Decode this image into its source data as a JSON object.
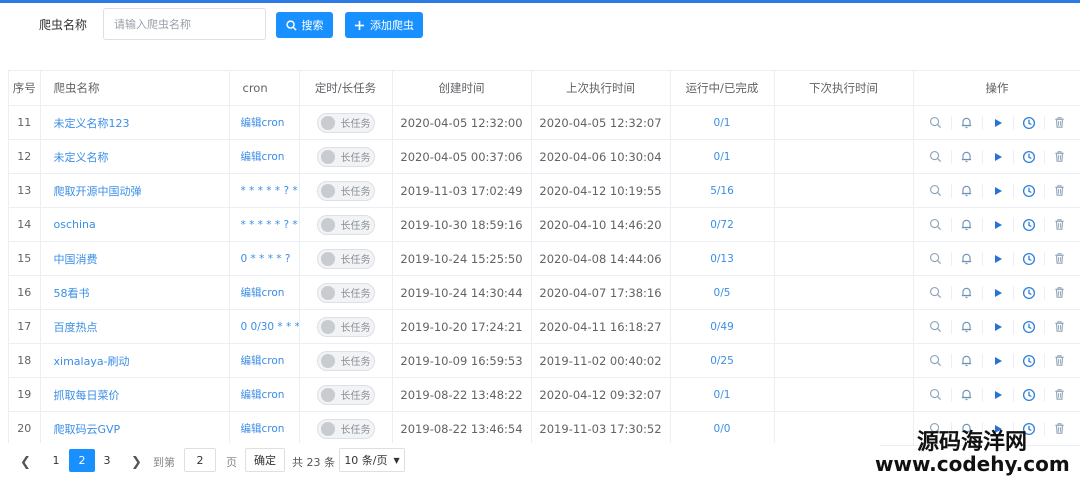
{
  "search": {
    "label": "爬虫名称",
    "placeholder": "请输入爬虫名称",
    "search_button": "搜索",
    "add_button": "添加爬虫"
  },
  "table": {
    "headers": {
      "index": "序号",
      "name": "爬虫名称",
      "cron": "cron",
      "task_type": "定时/长任务",
      "created": "创建时间",
      "last_run": "上次执行时间",
      "progress": "运行中/已完成",
      "next_run": "下次执行时间",
      "actions": "操作"
    },
    "switch_label": "长任务",
    "rows": [
      {
        "index": "11",
        "name": "未定义名称123",
        "cron": "编辑cron",
        "created": "2020-04-05 12:32:00",
        "last_run": "2020-04-05 12:32:07",
        "progress": "0/1",
        "next_run": ""
      },
      {
        "index": "12",
        "name": "未定义名称",
        "cron": "编辑cron",
        "created": "2020-04-05 00:37:06",
        "last_run": "2020-04-06 10:30:04",
        "progress": "0/1",
        "next_run": ""
      },
      {
        "index": "13",
        "name": "爬取开源中国动弹",
        "cron": "* * * * * ? * ...",
        "created": "2019-11-03 17:02:49",
        "last_run": "2020-04-12 10:19:55",
        "progress": "5/16",
        "next_run": ""
      },
      {
        "index": "14",
        "name": "oschina",
        "cron": "* * * * * ? * ...",
        "created": "2019-10-30 18:59:16",
        "last_run": "2020-04-10 14:46:20",
        "progress": "0/72",
        "next_run": ""
      },
      {
        "index": "15",
        "name": "中国消费",
        "cron": "0 * * * * ?",
        "created": "2019-10-24 15:25:50",
        "last_run": "2020-04-08 14:44:06",
        "progress": "0/13",
        "next_run": ""
      },
      {
        "index": "16",
        "name": "58看书",
        "cron": "编辑cron",
        "created": "2019-10-24 14:30:44",
        "last_run": "2020-04-07 17:38:16",
        "progress": "0/5",
        "next_run": ""
      },
      {
        "index": "17",
        "name": "百度热点",
        "cron": "0 0/30 * * * ?",
        "created": "2019-10-20 17:24:21",
        "last_run": "2020-04-11 16:18:27",
        "progress": "0/49",
        "next_run": ""
      },
      {
        "index": "18",
        "name": "ximalaya-刷动",
        "cron": "编辑cron",
        "created": "2019-10-09 16:59:53",
        "last_run": "2019-11-02 00:40:02",
        "progress": "0/25",
        "next_run": ""
      },
      {
        "index": "19",
        "name": "抓取每日菜价",
        "cron": "编辑cron",
        "created": "2019-08-22 13:48:22",
        "last_run": "2020-04-12 09:32:07",
        "progress": "0/1",
        "next_run": ""
      },
      {
        "index": "20",
        "name": "爬取码云GVP",
        "cron": "编辑cron",
        "created": "2019-08-22 13:46:54",
        "last_run": "2019-11-03 17:30:52",
        "progress": "0/0",
        "next_run": ""
      }
    ],
    "action_icons": [
      "search-icon",
      "bell-icon",
      "play-icon",
      "clock-icon",
      "trash-icon"
    ]
  },
  "pager": {
    "pages": [
      "1",
      "2",
      "3"
    ],
    "current": "2",
    "goto_label": "到第",
    "goto_value": "2",
    "page_unit": "页",
    "confirm": "确定",
    "total": "共 23 条",
    "page_size": "10 条/页"
  },
  "watermark": {
    "line1": "源码海洋网",
    "line2": "www.codehy.com"
  },
  "colors": {
    "accent": "#1890ff",
    "link": "#3a8ee6",
    "border": "#ebeef5"
  }
}
